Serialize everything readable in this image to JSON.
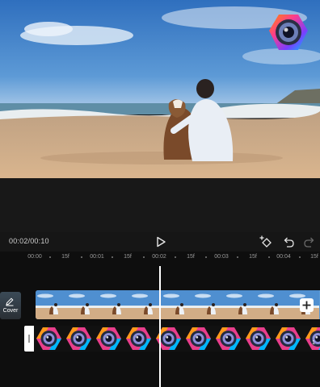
{
  "player": {
    "timecode": "00:02/00:10"
  },
  "icons": {
    "play": "play-icon",
    "keyframe": "keyframe-add-icon",
    "undo": "undo-icon",
    "redo": "redo-icon",
    "cover_edit": "pencil-icon",
    "add_clip": "plus-icon",
    "app_logo": "camera-lens-logo"
  },
  "ruler": {
    "labels": [
      "00:00",
      "15f",
      "00:01",
      "15f",
      "00:02",
      "15f",
      "00:03",
      "15f",
      "00:04",
      "15f"
    ]
  },
  "timeline": {
    "cover_label": "Cover",
    "overlay_badge": "1"
  },
  "colors": {
    "background": "#161616",
    "timeline_bg": "#0e0e0e",
    "playhead": "#ffffff",
    "sky": "#3d83c9",
    "sand": "#c9a27c"
  }
}
